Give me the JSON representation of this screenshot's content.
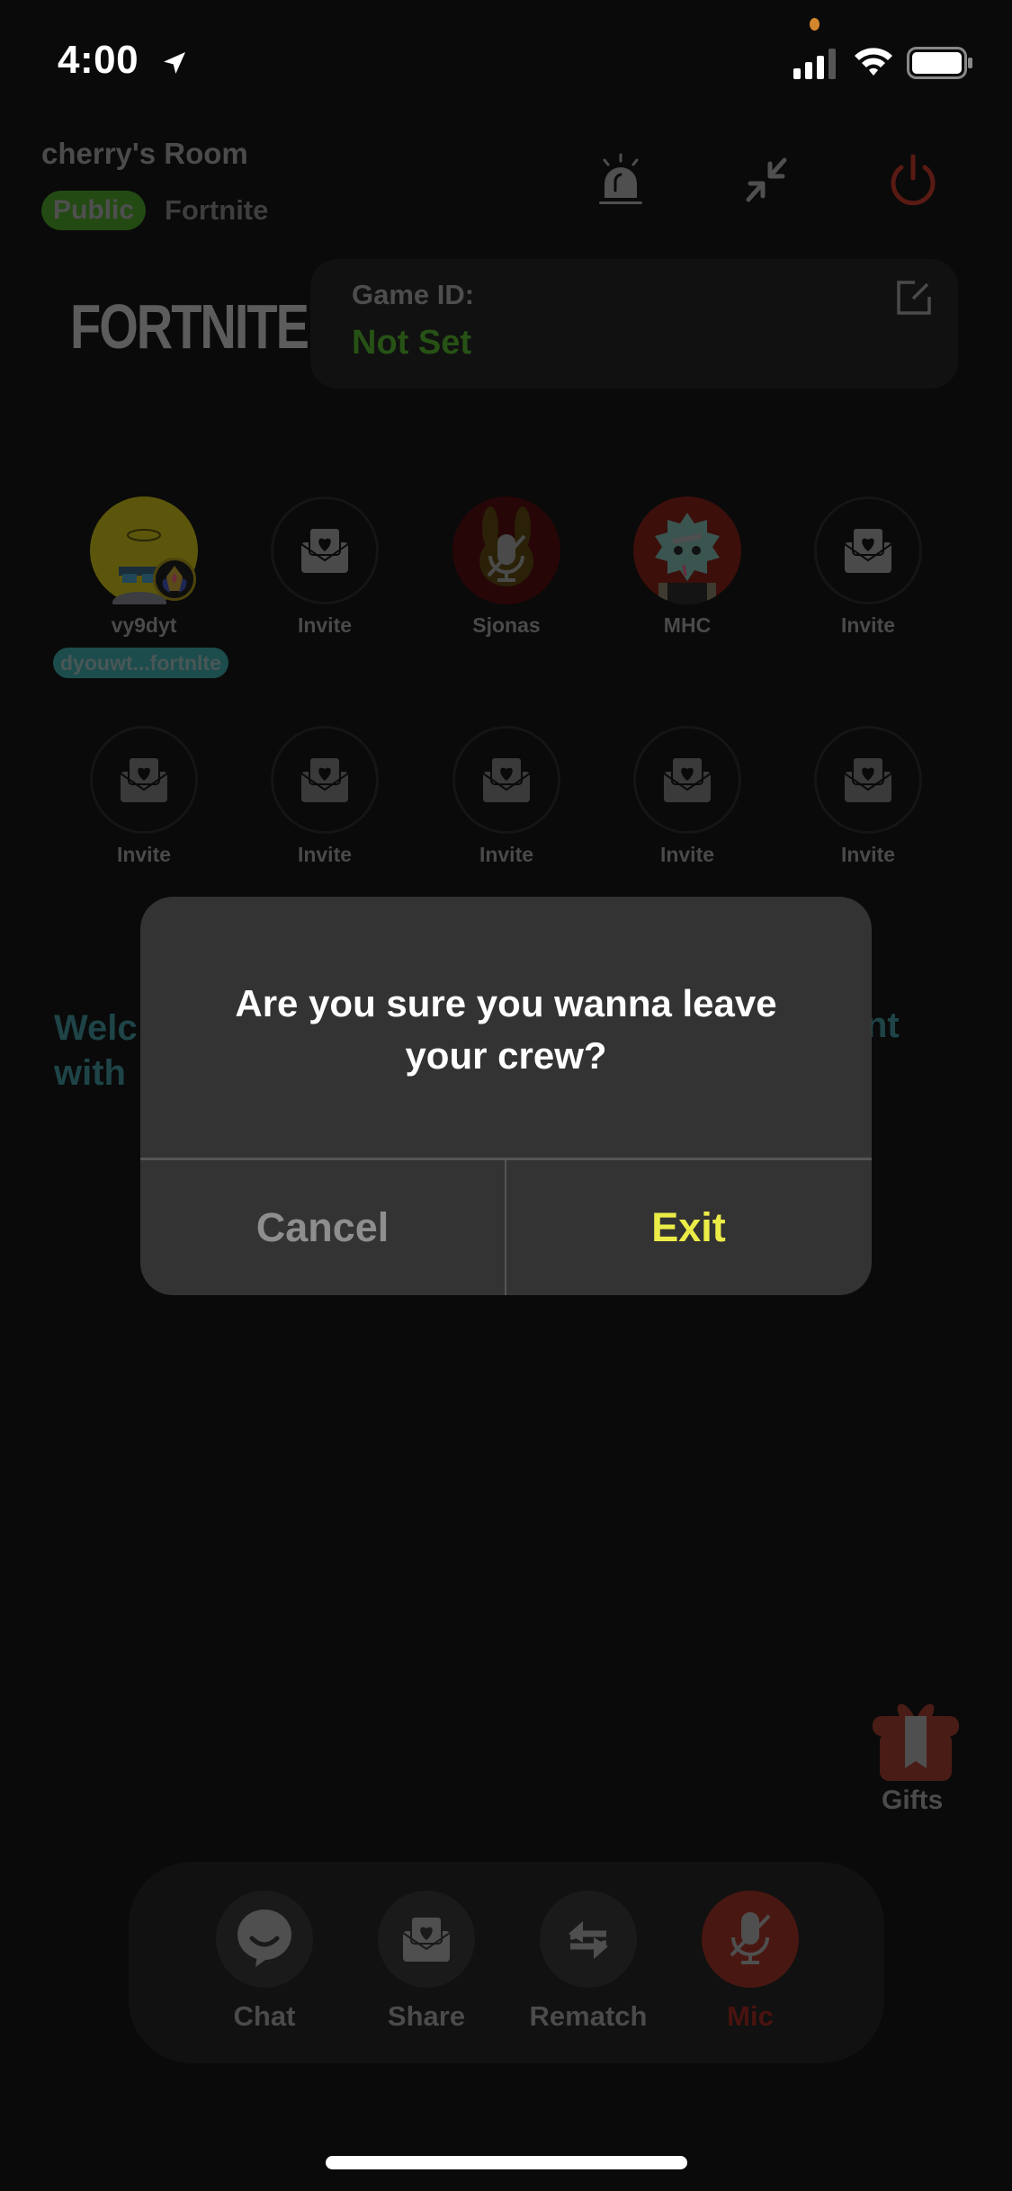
{
  "status_bar": {
    "time": "4:00",
    "icons": [
      "location-arrow-icon",
      "privacy-dot",
      "cellular-signal-icon",
      "wifi-icon",
      "battery-icon"
    ]
  },
  "header": {
    "room_title": "cherry's Room",
    "visibility_badge": "Public",
    "game_tag": "Fortnite",
    "actions": [
      "alarm-icon",
      "minimize-icon",
      "power-icon"
    ]
  },
  "game_card": {
    "logo_text": "FORTNITE",
    "label": "Game ID:",
    "value": "Not Set",
    "edit_icon": "edit-icon"
  },
  "members": {
    "row1": [
      {
        "name": "vy9dyt",
        "type": "user",
        "avatar": "yellow-avatar",
        "tag": "dyouwt...fortnlte"
      },
      {
        "name": "Invite",
        "type": "invite"
      },
      {
        "name": "Sjonas",
        "type": "user",
        "avatar": "bunny-avatar-muted"
      },
      {
        "name": "MHC",
        "type": "user",
        "avatar": "sun-character-avatar"
      },
      {
        "name": "Invite",
        "type": "invite"
      }
    ],
    "row2": [
      {
        "name": "Invite",
        "type": "invite"
      },
      {
        "name": "Invite",
        "type": "invite"
      },
      {
        "name": "Invite",
        "type": "invite"
      },
      {
        "name": "Invite",
        "type": "invite"
      },
      {
        "name": "Invite",
        "type": "invite"
      }
    ]
  },
  "welcome": {
    "line1_start": "Welc",
    "line1_end": "nt",
    "line2_start": "with"
  },
  "gifts": {
    "label": "Gifts"
  },
  "bottom_bar": {
    "items": [
      {
        "label": "Chat",
        "icon": "chat-bubble-icon"
      },
      {
        "label": "Share",
        "icon": "envelope-heart-icon"
      },
      {
        "label": "Rematch",
        "icon": "swap-arrows-icon"
      },
      {
        "label": "Mic",
        "icon": "mic-muted-icon"
      }
    ]
  },
  "dialog": {
    "message": "Are you sure you wanna leave your crew?",
    "cancel_label": "Cancel",
    "exit_label": "Exit"
  },
  "colors": {
    "background": "#0a0a0a",
    "accent_exit": "#ecec48",
    "public_badge": "#244a14",
    "game_id_value": "#275215",
    "mic_muted": "#491711",
    "power": "#5a1a14"
  }
}
